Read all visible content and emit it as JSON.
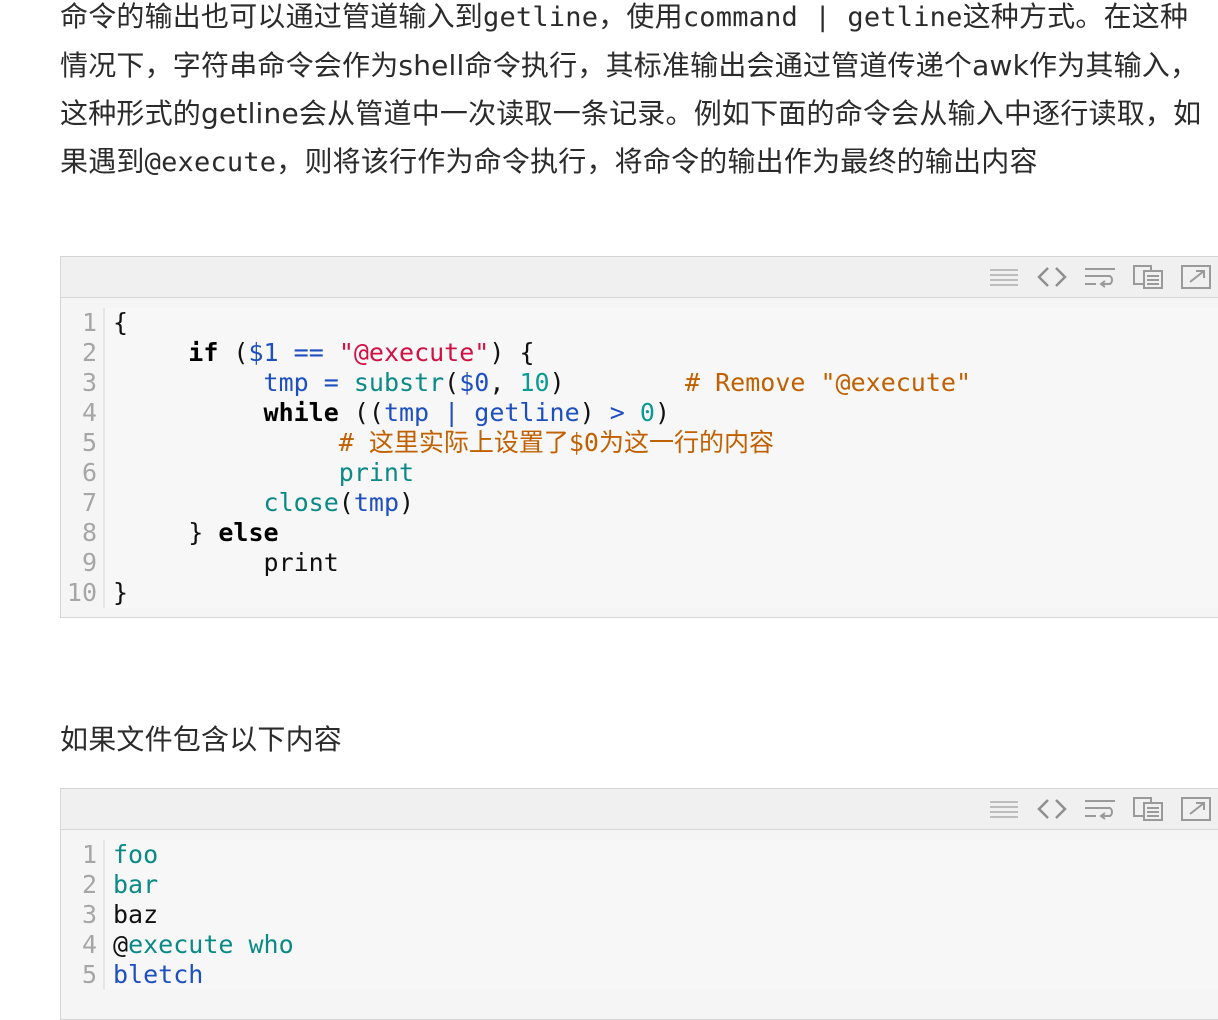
{
  "para1": {
    "text_a": "命令的输出也可以通过管道输入到",
    "code_a": "getline",
    "text_b": "，使用",
    "code_b": "command  |  getline",
    "text_c": "这种方式。在这种情况下，字符串命令会作为shell命令执行，其标准输出会通过管道传递个awk作为其输入，这种形式的getline会从管道中一次读取一条记录。例如下面的命令会从输入中逐行读取，如果遇到",
    "code_c": "@execute",
    "text_d": "，则将该行作为命令执行，将命令的输出作为最终的输出内容"
  },
  "para2": {
    "text": "如果文件包含以下内容"
  },
  "toolbar": {
    "icons": [
      "view-source-icon",
      "code-icon",
      "wrap-icon",
      "copy-icon",
      "popup-icon"
    ]
  },
  "block1": {
    "lines": [
      {
        "n": "1",
        "parts": [
          [
            "plain",
            "{"
          ]
        ]
      },
      {
        "n": "2",
        "parts": [
          [
            "plain",
            "     "
          ],
          [
            "kw",
            "if"
          ],
          [
            "plain",
            " ("
          ],
          [
            "var",
            "$1"
          ],
          [
            "plain",
            " "
          ],
          [
            "op",
            "=="
          ],
          [
            "plain",
            " "
          ],
          [
            "str",
            "\"@execute\""
          ],
          [
            "plain",
            ") {"
          ]
        ]
      },
      {
        "n": "3",
        "parts": [
          [
            "plain",
            "          "
          ],
          [
            "var",
            "tmp"
          ],
          [
            "plain",
            " "
          ],
          [
            "op",
            "="
          ],
          [
            "plain",
            " "
          ],
          [
            "fn",
            "substr"
          ],
          [
            "plain",
            "("
          ],
          [
            "var",
            "$0"
          ],
          [
            "plain",
            ", "
          ],
          [
            "num",
            "10"
          ],
          [
            "plain",
            ")        "
          ],
          [
            "cm",
            "# Remove \"@execute\""
          ]
        ]
      },
      {
        "n": "4",
        "parts": [
          [
            "plain",
            "          "
          ],
          [
            "kw",
            "while"
          ],
          [
            "plain",
            " (("
          ],
          [
            "var",
            "tmp"
          ],
          [
            "plain",
            " "
          ],
          [
            "op",
            "|"
          ],
          [
            "plain",
            " "
          ],
          [
            "var",
            "getline"
          ],
          [
            "plain",
            ") "
          ],
          [
            "op",
            ">"
          ],
          [
            "plain",
            " "
          ],
          [
            "num",
            "0"
          ],
          [
            "plain",
            ")"
          ]
        ]
      },
      {
        "n": "5",
        "parts": [
          [
            "plain",
            "               "
          ],
          [
            "cm",
            "# 这里实际上设置了$0为这一行的内容"
          ]
        ]
      },
      {
        "n": "6",
        "parts": [
          [
            "plain",
            "               "
          ],
          [
            "fn",
            "print"
          ]
        ]
      },
      {
        "n": "7",
        "parts": [
          [
            "plain",
            "          "
          ],
          [
            "fn",
            "close"
          ],
          [
            "plain",
            "("
          ],
          [
            "var",
            "tmp"
          ],
          [
            "plain",
            ")"
          ]
        ]
      },
      {
        "n": "8",
        "parts": [
          [
            "plain",
            "     } "
          ],
          [
            "kw",
            "else"
          ]
        ]
      },
      {
        "n": "9",
        "parts": [
          [
            "plain",
            "          print"
          ]
        ]
      },
      {
        "n": "10",
        "parts": [
          [
            "plain",
            "}"
          ]
        ]
      }
    ]
  },
  "block2": {
    "lines": [
      {
        "n": "1",
        "parts": [
          [
            "fn",
            "foo"
          ]
        ]
      },
      {
        "n": "2",
        "parts": [
          [
            "fn",
            "bar"
          ]
        ]
      },
      {
        "n": "3",
        "parts": [
          [
            "plain",
            "baz"
          ]
        ]
      },
      {
        "n": "4",
        "parts": [
          [
            "plain",
            "@"
          ],
          [
            "fn",
            "execute"
          ],
          [
            "plain",
            " "
          ],
          [
            "fn",
            "who"
          ]
        ]
      },
      {
        "n": "5",
        "parts": [
          [
            "var",
            "bletch"
          ]
        ]
      }
    ]
  }
}
